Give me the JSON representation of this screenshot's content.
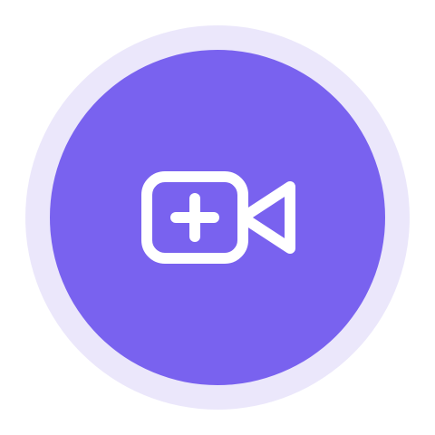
{
  "button": {
    "icon": "video-plus-icon",
    "accessible_label": ""
  },
  "colors": {
    "halo": "#ebe7fb",
    "disc": "#7962ef",
    "icon_stroke": "#ffffff",
    "background": "#ffffff"
  }
}
